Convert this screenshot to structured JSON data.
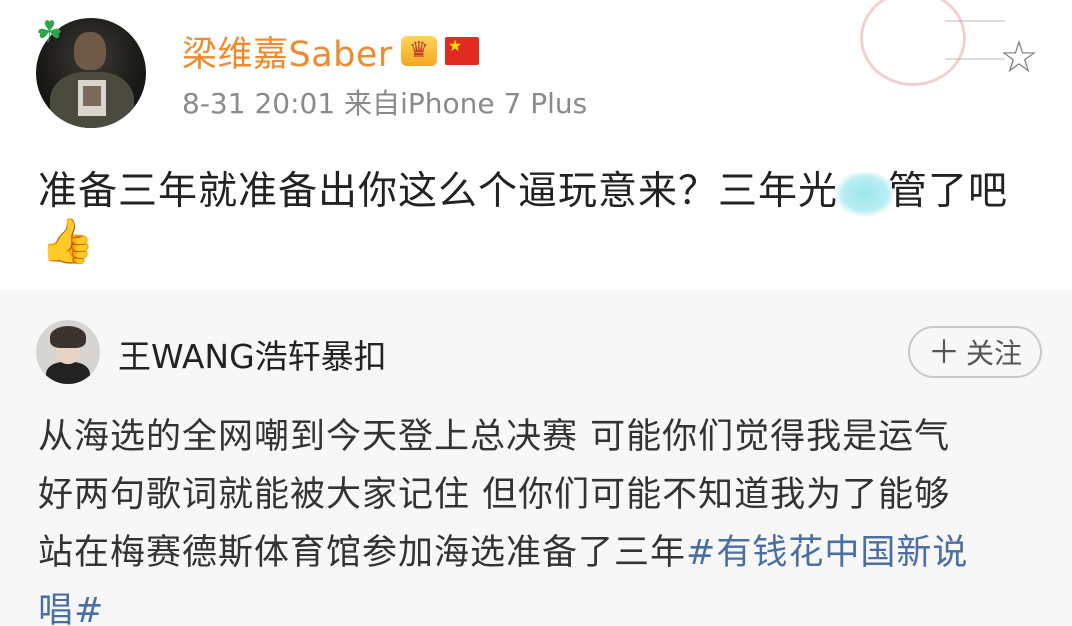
{
  "post": {
    "username": "梁维嘉Saber",
    "timestamp": "8-31 20:01",
    "source_prefix": "来自",
    "device": "iPhone 7 Plus",
    "text_before_blur": "准备三年就准备出你这么个逼玩意来？三年光",
    "text_after_blur": "管了吧",
    "thumb_emoji": "👍",
    "badge_icon": "crown-badge-icon",
    "flag_icon": "china-flag-icon",
    "favorite_icon": "star-outline-icon",
    "accent_color": "#f08a2c"
  },
  "repost": {
    "username": "王WANG浩轩暴扣",
    "follow_label": "关注",
    "follow_plus": "＋",
    "lines": [
      "从海选的全网嘲到今天登上总决赛 可能你们觉得我是运气",
      "好两句歌词就能被大家记住 但你们可能不知道我为了能够",
      "站在梅赛德斯体育馆参加海选准备了三年"
    ],
    "hashtag_part1": "#有钱花中国新说",
    "hashtag_part2": "唱#",
    "hashtag_color": "#4a6fa5"
  }
}
